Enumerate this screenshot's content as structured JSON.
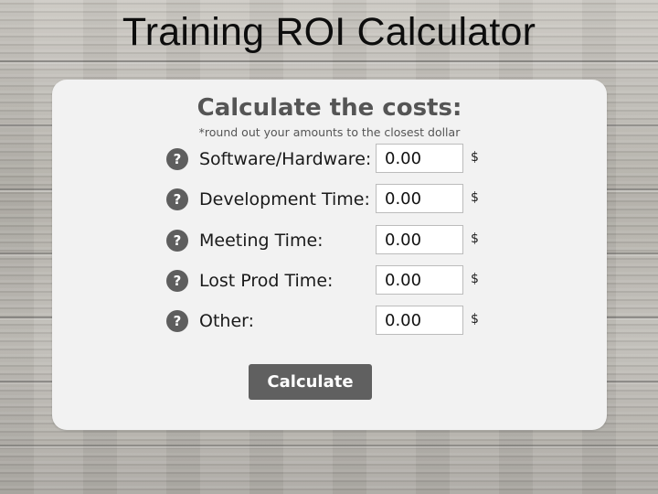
{
  "page": {
    "title": "Training ROI Calculator"
  },
  "card": {
    "heading": "Calculate the costs:",
    "note": "*round out your amounts to the closest dollar",
    "rows": [
      {
        "label": "Software/Hardware:",
        "value": "0.00",
        "currency": "$",
        "help_icon": "?"
      },
      {
        "label": "Development Time:",
        "value": "0.00",
        "currency": "$",
        "help_icon": "?"
      },
      {
        "label": "Meeting Time:",
        "value": "0.00",
        "currency": "$",
        "help_icon": "?"
      },
      {
        "label": "Lost Prod Time:",
        "value": "0.00",
        "currency": "$",
        "help_icon": "?"
      },
      {
        "label": "Other:",
        "value": "0.00",
        "currency": "$",
        "help_icon": "?"
      }
    ],
    "button_label": "Calculate"
  },
  "colors": {
    "card_background": "#f2f2f2",
    "heading_text": "#555555",
    "button_background": "#606060",
    "help_icon_background": "#5e5e5e"
  },
  "icons": {
    "help": "help-icon",
    "background": "wood-texture"
  }
}
